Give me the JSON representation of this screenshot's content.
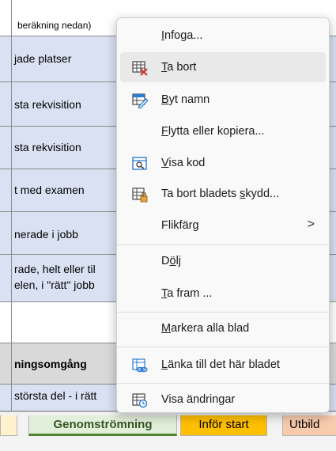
{
  "sheet": {
    "rows": [
      {
        "text": "beräkning nedan)"
      },
      {
        "text": "jade platser"
      },
      {
        "text": "sta rekvisition"
      },
      {
        "text": "sta rekvisition"
      },
      {
        "text": "t med examen"
      },
      {
        "text": "nerade i jobb"
      },
      {
        "line1": "rade, helt eller til",
        "line2": "elen, i \"rätt\" jobb"
      },
      {
        "text": ""
      },
      {
        "text": "ningsomgång"
      },
      {
        "text": "största del - i rätt"
      }
    ]
  },
  "tabs": {
    "active": "Genomströmning",
    "infor": "Inför start",
    "utbild": "Utbild"
  },
  "menu": {
    "items": [
      {
        "pre": "",
        "key": "I",
        "post": "nfoga...",
        "icon": "none"
      },
      {
        "pre": "",
        "key": "T",
        "post": "a bort",
        "icon": "delete-sheet-icon"
      },
      {
        "pre": "",
        "key": "B",
        "post": "yt namn",
        "icon": "rename-sheet-icon"
      },
      {
        "pre": "",
        "key": "F",
        "post": "lytta eller kopiera...",
        "icon": "none"
      },
      {
        "pre": "",
        "key": "V",
        "post": "isa kod",
        "icon": "view-code-icon"
      },
      {
        "pre": "Ta bort bladets ",
        "key": "s",
        "post": "kydd...",
        "icon": "unprotect-sheet-icon"
      },
      {
        "pre": "Flikfär",
        "key": "g",
        "post": "",
        "icon": "none",
        "submenu": ">"
      },
      {
        "pre": "D",
        "key": "ö",
        "post": "lj",
        "icon": "none"
      },
      {
        "pre": "",
        "key": "T",
        "post": "a fram ...",
        "icon": "none"
      },
      {
        "pre": "",
        "key": "M",
        "post": "arkera alla blad",
        "icon": "none"
      },
      {
        "pre": "",
        "key": "L",
        "post": "änka till det här bladet",
        "icon": "link-sheet-icon"
      },
      {
        "pre": "Visa ändrin",
        "key": "g",
        "post": "ar",
        "icon": "show-changes-icon"
      }
    ]
  }
}
